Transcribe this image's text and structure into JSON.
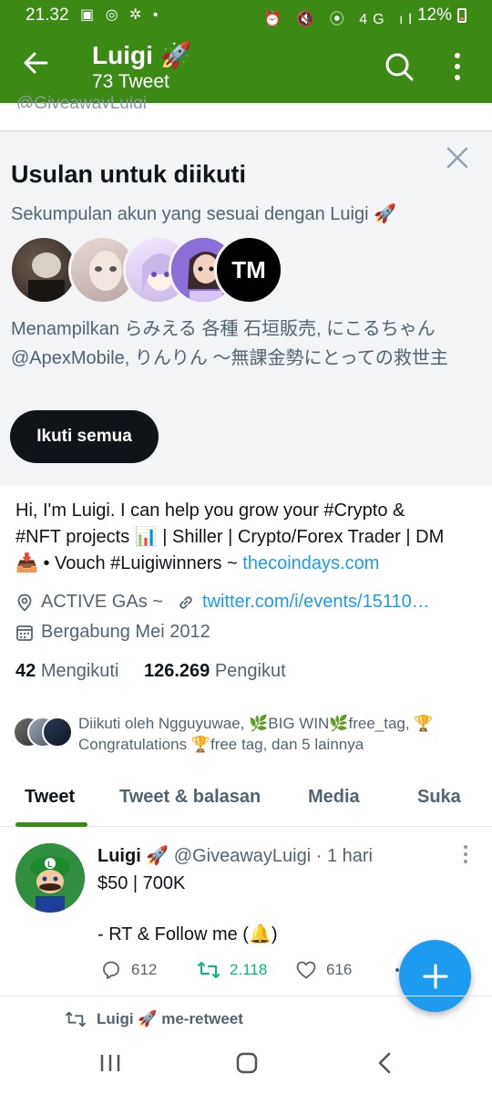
{
  "status_bar": {
    "time": "21.32",
    "left_icons": "▣ ◎ ✲ •",
    "right_icons": "⏰ 🔇 ⦿ 4G ıl",
    "battery": "12%"
  },
  "header": {
    "name": "Luigi 🚀",
    "subtitle": "73 Tweet"
  },
  "profile": {
    "handle_peek": "@GiveawayLuigi"
  },
  "suggestions": {
    "title": "Usulan untuk diikuti",
    "subtitle": "Sekumpulan akun yang sesuai dengan Luigi 🚀",
    "description_line1": "Menampilkan らみえる 各種 石垣販売, にこるちゃん",
    "description_line2": "@ApexMobile, りんりん 〜無課金勢にとっての救世主",
    "follow_all_label": "Ikuti semua",
    "logo_text": "TM"
  },
  "bio": {
    "line1": "Hi, I'm Luigi. I can help you grow your #Crypto &",
    "line2": "#NFT projects 📊 | Shiller | Crypto/Forex Trader | DM",
    "line3_prefix": "📥 • Vouch #Luigiwinners ~ ",
    "line3_link": "thecoindays.com",
    "location": "ACTIVE GAs ~",
    "website": "twitter.com/i/events/15110…",
    "joined": "Bergabung Mei 2012"
  },
  "counts": {
    "following_count": "42",
    "following_label": "Mengikuti",
    "followers_count": "126.269",
    "followers_label": "Pengikut"
  },
  "followed_by": {
    "line1": "Diikuti oleh Ngguyuwae, 🌿BIG WIN🌿free_tag, 🏆",
    "line2": "Congratulations 🏆free tag, dan 5 lainnya"
  },
  "tabs": [
    {
      "label": "Tweet"
    },
    {
      "label": "Tweet & balasan"
    },
    {
      "label": "Media"
    },
    {
      "label": "Suka"
    }
  ],
  "tweet": {
    "name": "Luigi 🚀",
    "handle": "@GiveawayLuigi",
    "time": "· 1 hari",
    "line1": "$50 | 700K",
    "line2": "",
    "line3": "- RT & Follow me (🔔)",
    "replies": "612",
    "retweets": "2.118",
    "likes": "616"
  },
  "retweet_row": {
    "text": "Luigi 🚀 me-retweet"
  },
  "colors": {
    "header_green": "#3b8a16",
    "accent_blue": "#1d9bf0",
    "retweet_green": "#00ba7c"
  }
}
